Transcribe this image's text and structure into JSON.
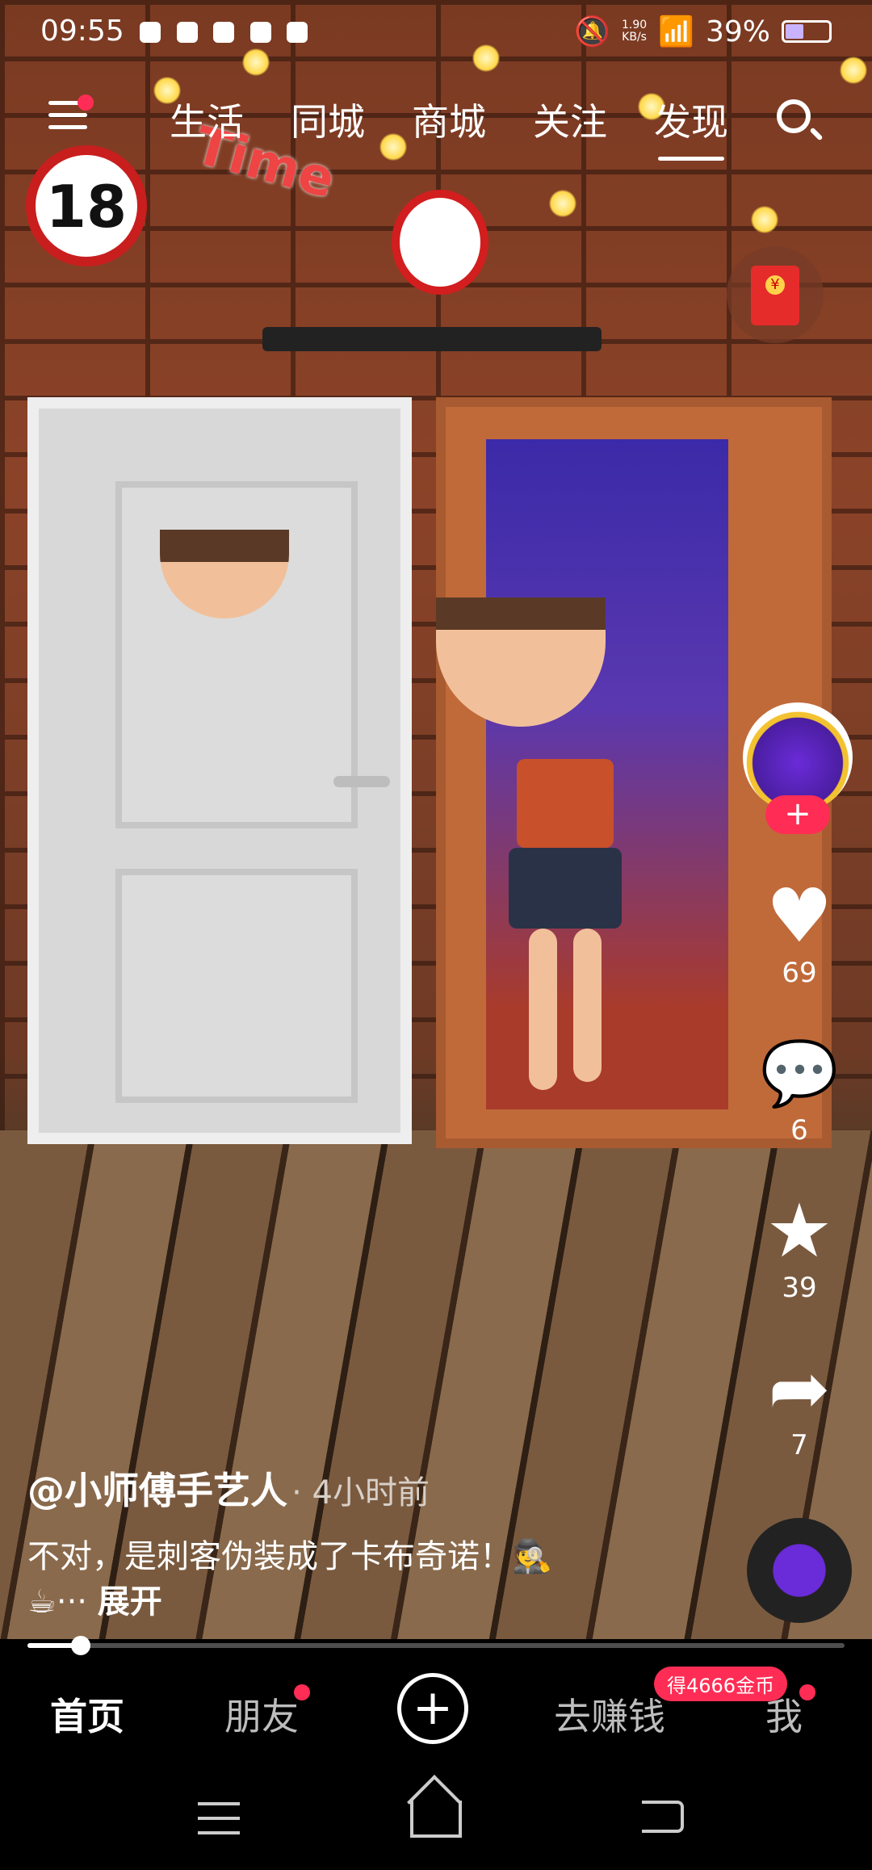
{
  "status_bar": {
    "time": "09:55",
    "net_speed_value": "1.90",
    "net_speed_unit": "KB/s",
    "battery": "39%"
  },
  "top_nav": {
    "tabs": [
      "生活",
      "同城",
      "商城",
      "关注",
      "发现"
    ],
    "active_tab": "发现",
    "menu_has_badge": true
  },
  "video": {
    "overlay_text_number": "18",
    "overlay_text_word": "Time",
    "author": "@小师傅手艺人",
    "time_ago": "· 4小时前",
    "description_line1": "不对，是刺客伪装成了卡布奇诺！🕵️",
    "description_line2_prefix": "☕··· ",
    "expand_label": "展开",
    "progress_fraction": 0.065
  },
  "actions": {
    "follow_symbol": "+",
    "likes": "69",
    "comments": "6",
    "favorites": "39",
    "shares": "7"
  },
  "bottom_nav": {
    "home": "首页",
    "friends": "朋友",
    "create_symbol": "+",
    "earn": "去赚钱",
    "earn_badge": "得4666金币",
    "me": "我"
  },
  "colors": {
    "accent": "#ff2d55",
    "badge": "#ff2d55"
  }
}
